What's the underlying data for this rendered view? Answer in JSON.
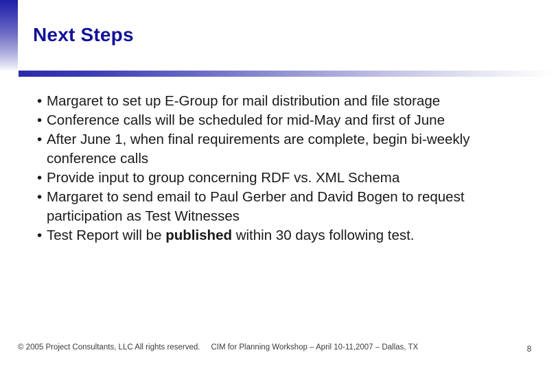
{
  "slide": {
    "title": "Next Steps",
    "bullet_char": "•",
    "bullets": [
      {
        "text_before": "Margaret to set up E-Group for mail distribution and file storage",
        "bold": "",
        "text_after": ""
      },
      {
        "text_before": "Conference calls will be scheduled for mid-May and first of June",
        "bold": "",
        "text_after": ""
      },
      {
        "text_before": "After June 1, when final requirements are complete, begin bi-weekly conference calls",
        "bold": "",
        "text_after": ""
      },
      {
        "text_before": "Provide input to group concerning RDF vs. XML Schema",
        "bold": "",
        "text_after": ""
      },
      {
        "text_before": "Margaret to send email to Paul Gerber and David Bogen to request participation as Test Witnesses",
        "bold": "",
        "text_after": ""
      },
      {
        "text_before": "Test Report will be ",
        "bold": "published",
        "text_after": " within 30 days following test."
      }
    ]
  },
  "footer": {
    "copyright": "© 2005 Project Consultants, LLC All rights reserved.",
    "event": "CIM for Planning Workshop – April 10-11,2007 – Dallas, TX",
    "page_number": "8"
  },
  "colors": {
    "title": "#11119b",
    "accent_bar_start": "#2a2aad",
    "body_text": "#1a1a1a",
    "footer_text": "#3b3b3b"
  }
}
